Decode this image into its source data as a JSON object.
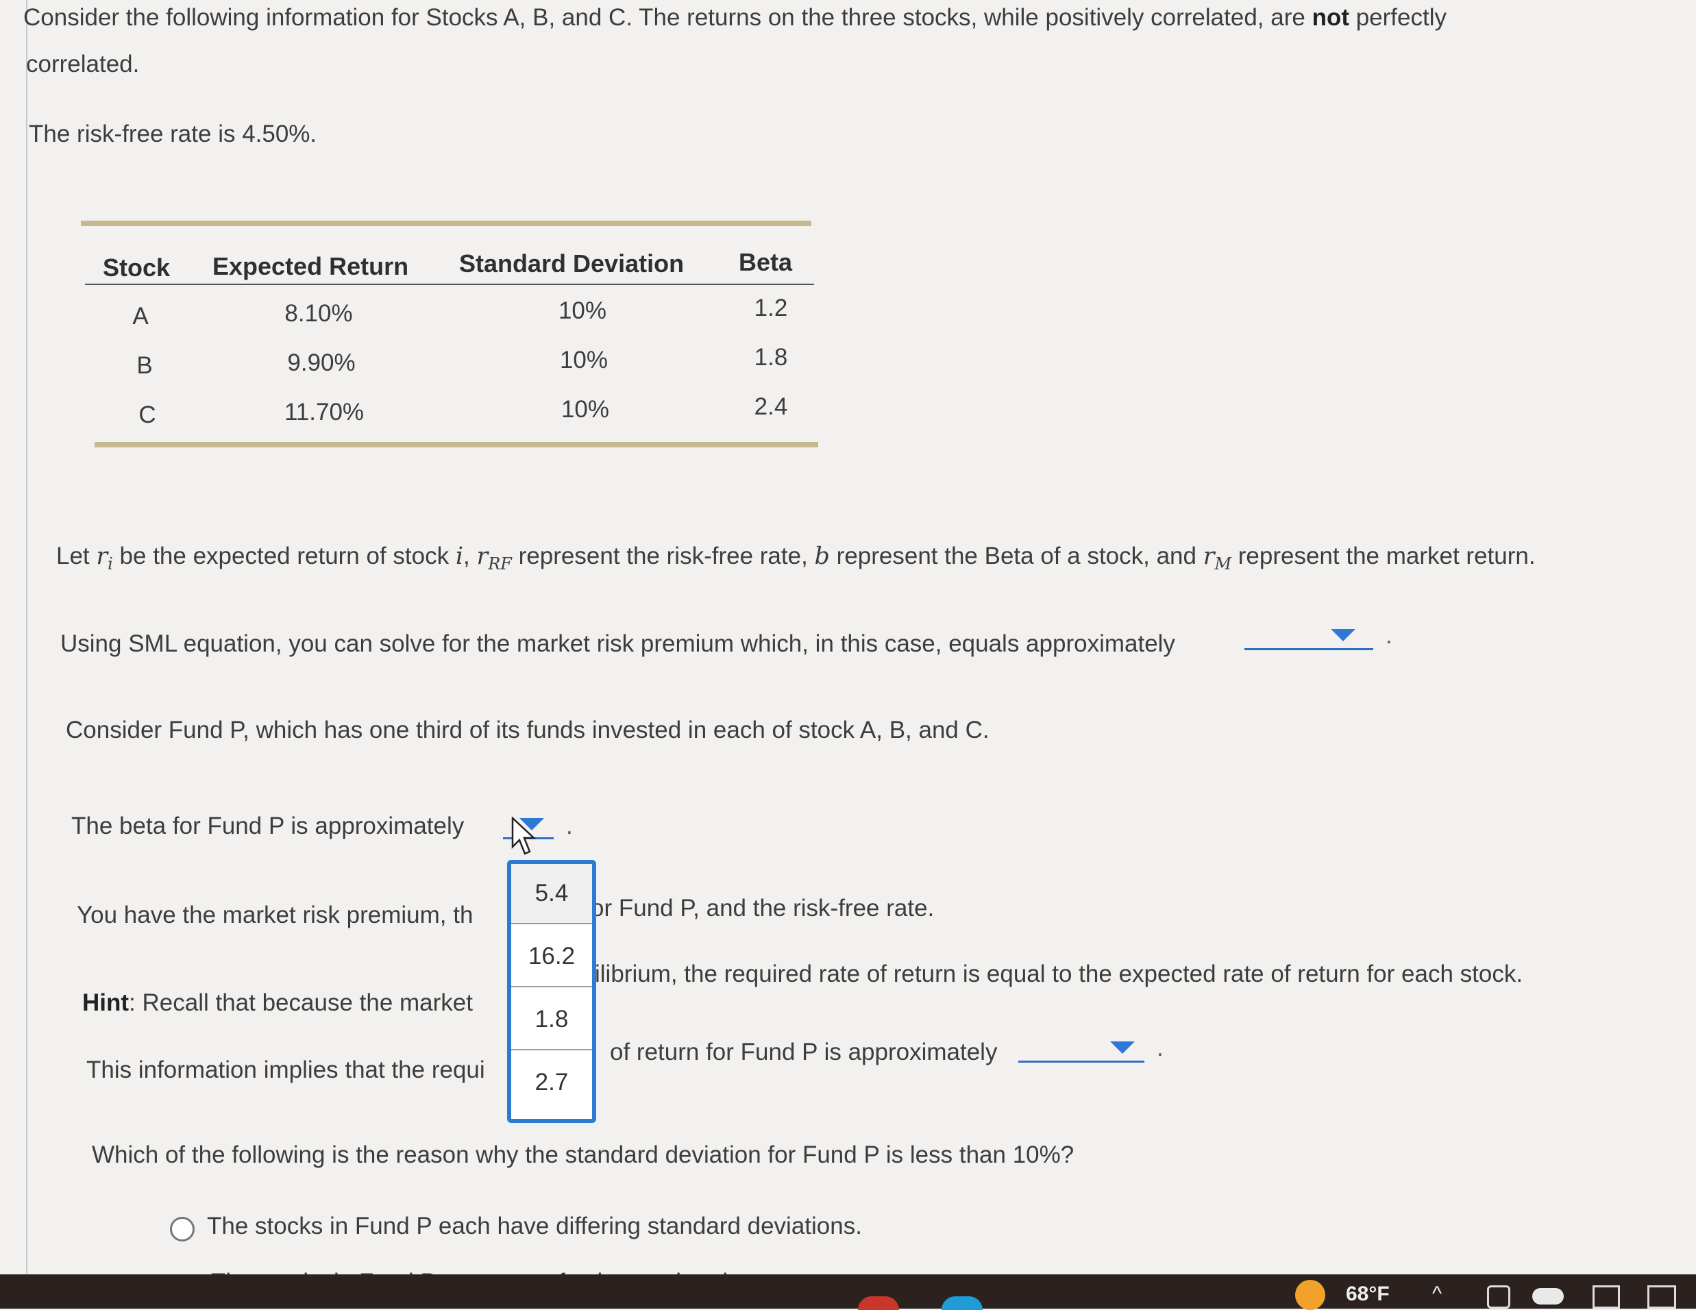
{
  "intro": {
    "text_before_bold": "Consider the following information for Stocks A, B, and C. The returns on the three stocks, while positively correlated, are ",
    "bold": "not",
    "text_after_bold": " perfectly",
    "line2": "correlated."
  },
  "risk_free_text": "The risk-free rate is 4.50%.",
  "table": {
    "headers": [
      "Stock",
      "Expected Return",
      "Standard Deviation",
      "Beta"
    ],
    "rows": [
      [
        "A",
        "8.10%",
        "10%",
        "1.2"
      ],
      [
        "B",
        "9.90%",
        "10%",
        "1.8"
      ],
      [
        "C",
        "11.70%",
        "10%",
        "2.4"
      ]
    ]
  },
  "definitions": {
    "p1": "Let ",
    "ri": "r",
    "ri_sub": "i",
    "p2": " be the expected return of stock ",
    "i": "i",
    "p3": ", ",
    "rrf": "r",
    "rrf_sub": "RF",
    "p4": " represent the risk-free rate, ",
    "b": "b",
    "p5": " represent the Beta of a stock, and ",
    "rm": "r",
    "rm_sub": "M",
    "p6": " represent the market return."
  },
  "q_sml": "Using SML equation, you can solve for the market risk premium which, in this case, equals approximately",
  "fund_text": "Consider Fund P, which has one third of its funds invested in each of stock A, B, and C.",
  "beta_text": "The beta for Fund P is approximately",
  "beta_dropdown_options": [
    "5.4",
    "16.2",
    "1.8",
    "2.7"
  ],
  "premium_left": "You have the market risk premium, th",
  "premium_right": "or Fund P, and the risk-free rate.",
  "hint": {
    "label": "Hint",
    "left": ": Recall that because the market",
    "right": "ilibrium, the required rate of return is equal to the expected rate of return for each stock."
  },
  "implies_left": "This information implies that the requi",
  "implies_right": "of return for Fund P is approximately",
  "question_std": "Which of the following is the reason why the standard deviation for Fund P is less than 10%?",
  "answers": [
    "The stocks in Fund P each have differing standard deviations.",
    "The stocks in Fund P are not perfectly correlated."
  ],
  "period": ".",
  "taskbar": {
    "temperature": "68°F",
    "chevron": "^"
  },
  "colors": {
    "accent": "#2f79d6",
    "table_rule": "#c7b98f",
    "taskbar": "#2b2220"
  }
}
